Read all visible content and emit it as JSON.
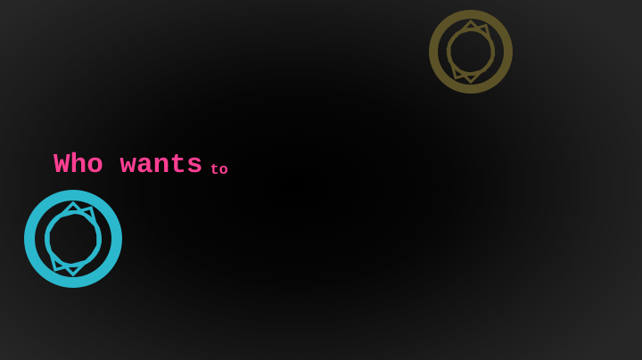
{
  "caption": {
    "line_main": "Who wants",
    "line_trailing": "to",
    "color": "#ff3f93"
  },
  "decorations": {
    "ring_cyan_color": "#2bb7cc",
    "ring_olive_color": "#5c5228",
    "icon_name": "octagon-ring-icon"
  }
}
